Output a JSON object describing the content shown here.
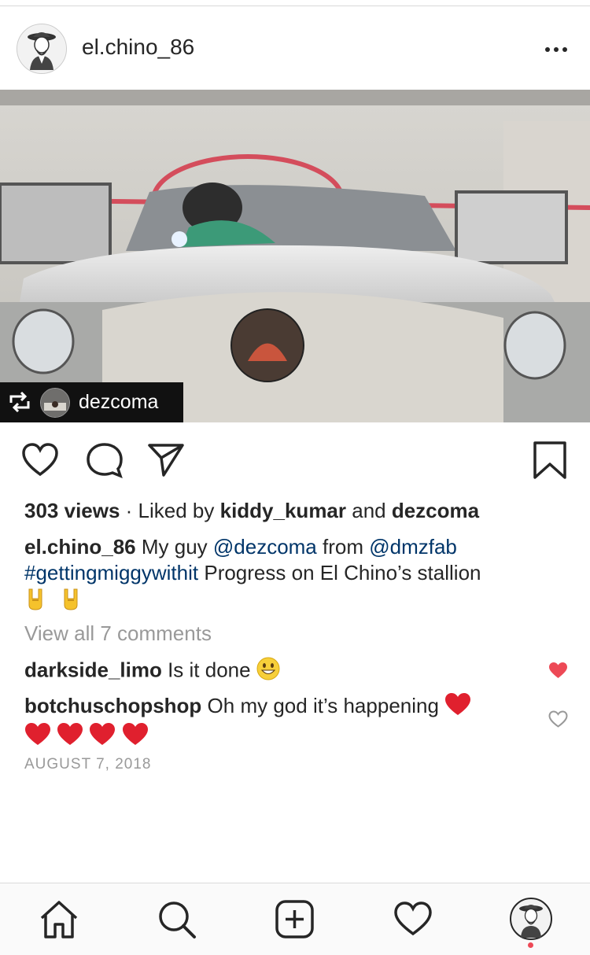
{
  "post": {
    "username": "el.chino_86",
    "repost_username": "dezcoma",
    "views": "303 views",
    "liked_by_sep": " · Liked by ",
    "liker1": "kiddy_kumar",
    "and": " and ",
    "liker2": "dezcoma",
    "caption_user": "el.chino_86",
    "caption_text1": " My guy ",
    "mention1": "@dezcoma",
    "caption_text2": " from ",
    "mention2": "@dmzfab",
    "hashtag": "#gettingmiggywithit",
    "caption_text3": " Progress on El Chino’s stallion",
    "view_all": "View all 7 comments",
    "date": "AUGUST 7, 2018"
  },
  "comments": [
    {
      "user": "darkside_limo",
      "text": " Is it done ",
      "liked": true
    },
    {
      "user": "botchuschopshop",
      "text": " Oh my god it’s happening ",
      "liked": false
    }
  ],
  "icons": [
    "more-icon",
    "repost-icon",
    "heart-icon",
    "comment-icon",
    "share-icon",
    "bookmark-icon",
    "home-icon",
    "search-icon",
    "new-post-icon",
    "activity-heart-icon",
    "profile-avatar"
  ],
  "colors": {
    "link": "#003569",
    "liked_heart": "#ed4956",
    "muted": "#999999"
  }
}
